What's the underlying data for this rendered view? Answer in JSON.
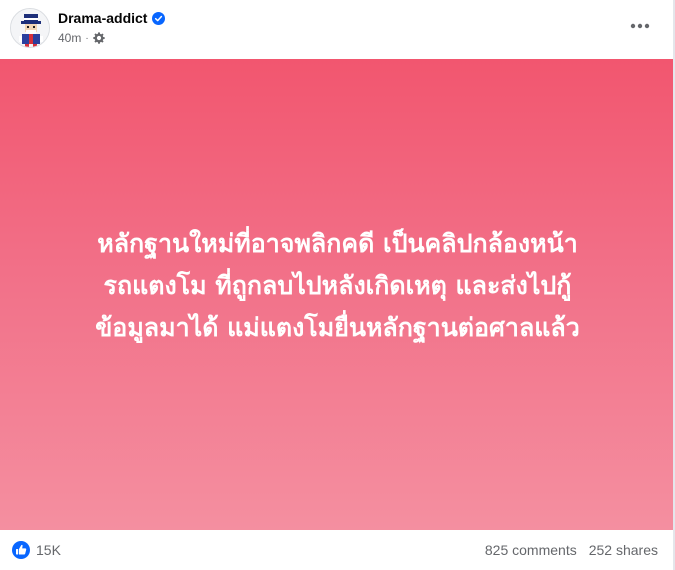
{
  "post": {
    "author": "Drama-addict",
    "time": "40m",
    "separator": "·",
    "verified_icon": "verified-badge-icon",
    "privacy_icon": "gear-icon",
    "more_icon": "more-dots-icon"
  },
  "content": {
    "lines": [
      "หลักฐานใหม่ที่อาจพลิกคดี เป็นคลิปกล้องหน้า",
      "รถแตงโม ที่ถูกลบไปหลังเกิดเหตุ และส่งไปกู้",
      "ข้อมูลมาได้ แม่แตงโมยื่นหลักฐานต่อศาลแล้ว"
    ],
    "background_top": "#f2566f",
    "background_bottom": "#f48fa0"
  },
  "footer": {
    "reaction_icon": "like-icon",
    "reaction_count": "15K",
    "comments": "825 comments",
    "shares": "252 shares"
  },
  "colors": {
    "brand_blue": "#0866ff",
    "secondary_text": "#65676b"
  }
}
